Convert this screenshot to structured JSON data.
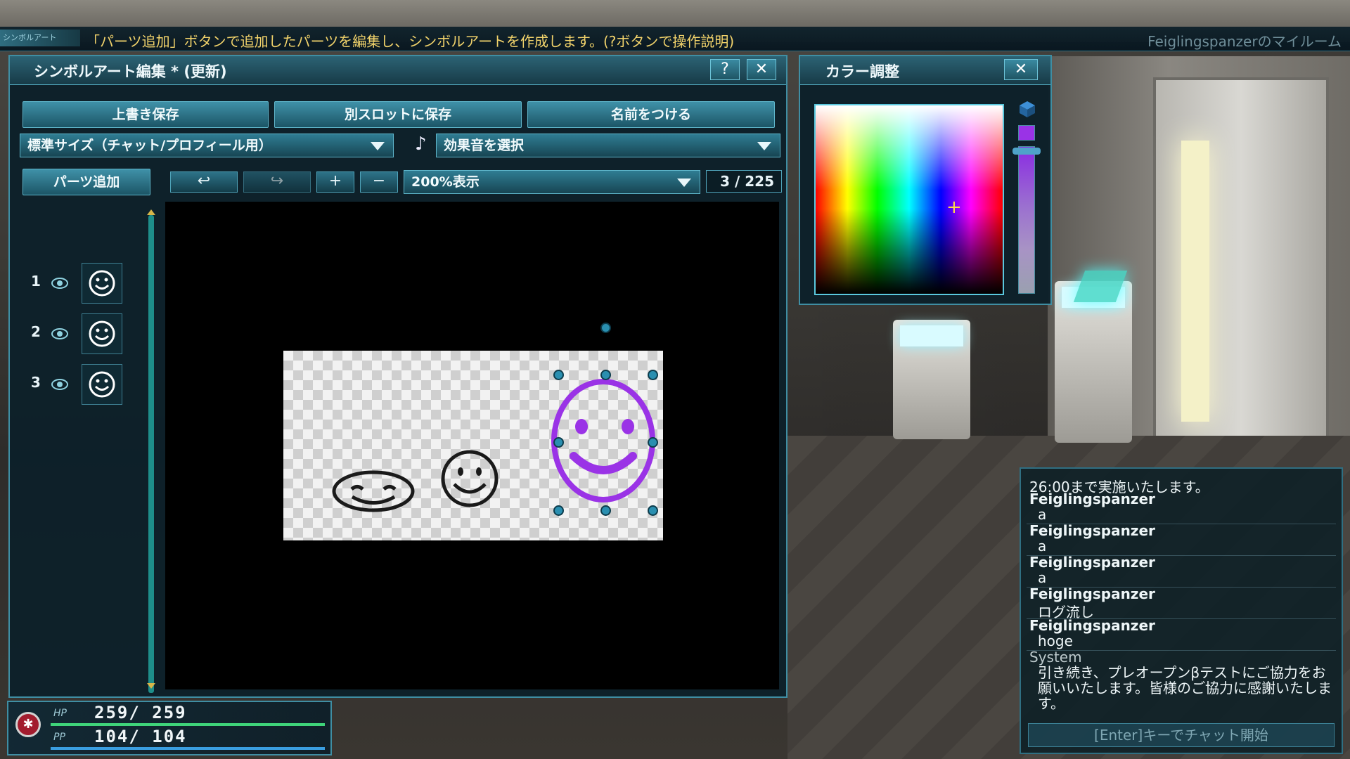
{
  "help_bar": {
    "tag": "シンボルアート",
    "text": "「パーツ追加」ボタンで追加したパーツを編集し、シンボルアートを作成します。(?ボタンで操作説明)",
    "room": "Feiglingspanzerのマイルーム"
  },
  "editor": {
    "title": "シンボルアート編集 * (更新)",
    "help_label": "?",
    "close_label": "✕",
    "overwrite_save": "上書き保存",
    "save_other_slot": "別スロットに保存",
    "name_it": "名前をつける",
    "size_select": "標準サイズ（チャット/プロフィール用）",
    "sound_icon": "♪",
    "sound_select": "効果音を選択",
    "add_parts": "パーツ追加",
    "undo_glyph": "↩",
    "redo_glyph": "↪",
    "zoom_in": "+",
    "zoom_out": "−",
    "zoom_select": "200%表示",
    "part_count": "3 / 225",
    "parts": [
      {
        "num": "1"
      },
      {
        "num": "2"
      },
      {
        "num": "3"
      }
    ]
  },
  "color_panel": {
    "title": "カラー調整",
    "close_label": "✕",
    "crosshair": "+",
    "selected_color": "#9a33e6"
  },
  "chat": {
    "lines": [
      {
        "type": "msg",
        "text": "26:00まで実施いたします。"
      },
      {
        "type": "name",
        "text": "Feiglingspanzer"
      },
      {
        "type": "msg",
        "text": "a"
      },
      {
        "type": "name",
        "text": "Feiglingspanzer"
      },
      {
        "type": "msg",
        "text": "a"
      },
      {
        "type": "name",
        "text": "Feiglingspanzer"
      },
      {
        "type": "msg",
        "text": "a"
      },
      {
        "type": "name",
        "text": "Feiglingspanzer"
      },
      {
        "type": "msg",
        "text": "ログ流し"
      },
      {
        "type": "name",
        "text": "Feiglingspanzer"
      },
      {
        "type": "msg",
        "text": "hoge"
      },
      {
        "type": "sys-name",
        "text": "System"
      },
      {
        "type": "sys",
        "text": "引き続き、プレオープンβテストにご協力をお願いいたします。皆様のご協力に感謝いたします。"
      }
    ],
    "enter_hint": "[Enter]キーでチャット開始"
  },
  "status": {
    "hp_label": "HP",
    "hp_value": "259/  259",
    "pp_label": "PP",
    "pp_value": "104/  104",
    "hp_fraction": 1.0,
    "pp_fraction": 1.0
  },
  "colors": {
    "accent": "#3f8ea3",
    "help_text": "#f2d36b",
    "smiley_purple": "#9a33e6"
  }
}
